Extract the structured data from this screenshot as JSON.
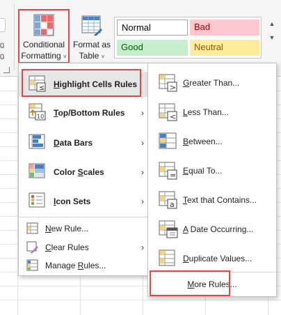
{
  "ribbon": {
    "left_stub_lines": [
      "0",
      "0"
    ],
    "conditional_formatting": {
      "line1": "Conditional",
      "line2": "Formatting",
      "chevron": "˅"
    },
    "format_as_table": {
      "line1": "Format as",
      "line2": "Table",
      "chevron": "˅"
    },
    "cell_styles": [
      {
        "label": "Normal",
        "name": "style-normal"
      },
      {
        "label": "Bad",
        "name": "style-bad"
      },
      {
        "label": "Good",
        "name": "style-good"
      },
      {
        "label": "Neutral",
        "name": "style-neutral"
      }
    ],
    "gallery_up": "▲",
    "gallery_down": "▼"
  },
  "menu": {
    "items": [
      {
        "key": "H",
        "rest": "ighlight Cells Rules",
        "icon": "highlight-cells-rules-icon",
        "arrow": "›"
      },
      {
        "key": "T",
        "rest": "op/Bottom Rules",
        "icon": "top-bottom-rules-icon",
        "arrow": "›"
      },
      {
        "key": "D",
        "rest": "ata Bars",
        "icon": "data-bars-icon",
        "arrow": "›"
      },
      {
        "key": "S",
        "pre": "Color ",
        "rest": "cales",
        "icon": "color-scales-icon",
        "arrow": "›"
      },
      {
        "key": "I",
        "rest": "con Sets",
        "icon": "icon-sets-icon",
        "arrow": "›"
      }
    ],
    "small_items": [
      {
        "key": "N",
        "rest": "ew Rule...",
        "icon": "new-rule-icon"
      },
      {
        "key": "C",
        "rest": "lear Rules",
        "icon": "clear-rules-icon",
        "arrow": "›"
      },
      {
        "key": "R",
        "pre": "Manage ",
        "rest": "ules...",
        "icon": "manage-rules-icon"
      }
    ]
  },
  "submenu": {
    "items": [
      {
        "key": "G",
        "rest": "reater Than...",
        "icon": "greater-than-icon",
        "sym": ">"
      },
      {
        "key": "L",
        "rest": "ess Than...",
        "icon": "less-than-icon",
        "sym": "<"
      },
      {
        "key": "B",
        "rest": "etween...",
        "icon": "between-icon",
        "sym": ""
      },
      {
        "key": "E",
        "rest": "qual To...",
        "icon": "equal-to-icon",
        "sym": "="
      },
      {
        "key": "T",
        "rest": "ext that Contains...",
        "icon": "text-contains-icon",
        "sym": "a"
      },
      {
        "key": "A",
        "rest": " Date Occurring...",
        "icon": "date-occurring-icon",
        "sym": ""
      },
      {
        "key": "D",
        "rest": "uplicate Values...",
        "icon": "duplicate-values-icon",
        "sym": ""
      }
    ],
    "more": {
      "key": "M",
      "rest": "ore Rules..."
    }
  },
  "colors": {
    "highlight_border": "#e04848",
    "bad_bg": "#ffc7ce",
    "bad_fg": "#9c0006",
    "good_bg": "#c6efce",
    "good_fg": "#006100",
    "neutral_bg": "#ffeb9c",
    "neutral_fg": "#9c5700"
  }
}
